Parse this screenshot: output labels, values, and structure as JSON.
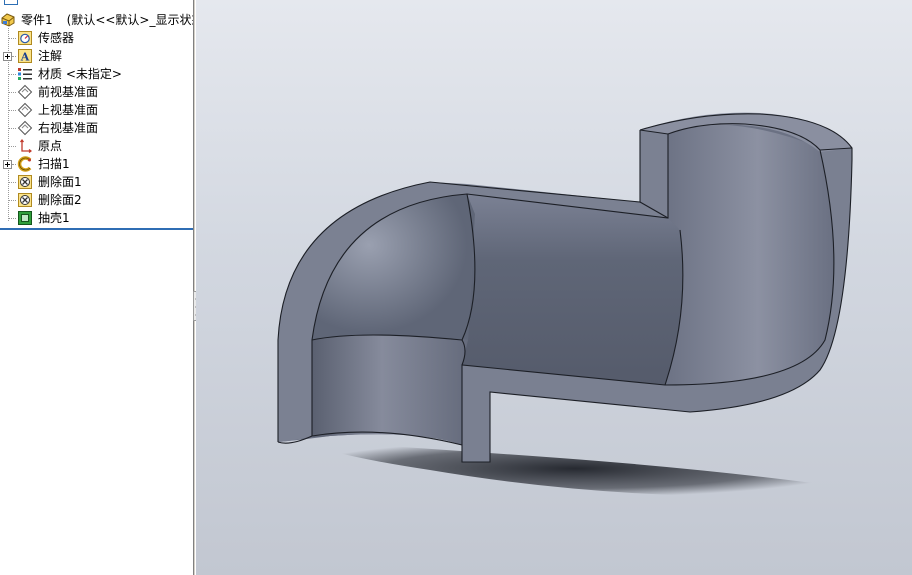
{
  "feature_tree": {
    "root": {
      "label": "零件1",
      "config": "(默认<<默认>_显示状态",
      "icon": "part-icon"
    },
    "items": [
      {
        "label": "传感器",
        "icon": "sensor-icon",
        "expandable": false
      },
      {
        "label": "注解",
        "icon": "annotation-icon",
        "expandable": true
      },
      {
        "label": "材质 <未指定>",
        "icon": "material-icon",
        "expandable": false
      },
      {
        "label": "前视基准面",
        "icon": "plane-icon",
        "expandable": false
      },
      {
        "label": "上视基准面",
        "icon": "plane-icon",
        "expandable": false
      },
      {
        "label": "右视基准面",
        "icon": "plane-icon",
        "expandable": false
      },
      {
        "label": "原点",
        "icon": "origin-icon",
        "expandable": false
      },
      {
        "label": "扫描1",
        "icon": "sweep-icon",
        "expandable": true
      },
      {
        "label": "删除面1",
        "icon": "delete-face-icon",
        "expandable": false
      },
      {
        "label": "删除面2",
        "icon": "delete-face-icon",
        "expandable": false
      },
      {
        "label": "抽壳1",
        "icon": "shell-icon",
        "expandable": false
      }
    ]
  },
  "viewport": {
    "model": "swept-pipe-section-model",
    "background_top": "#e5e8ee",
    "background_bottom": "#c2c7d1",
    "model_color": "#5f6677"
  }
}
